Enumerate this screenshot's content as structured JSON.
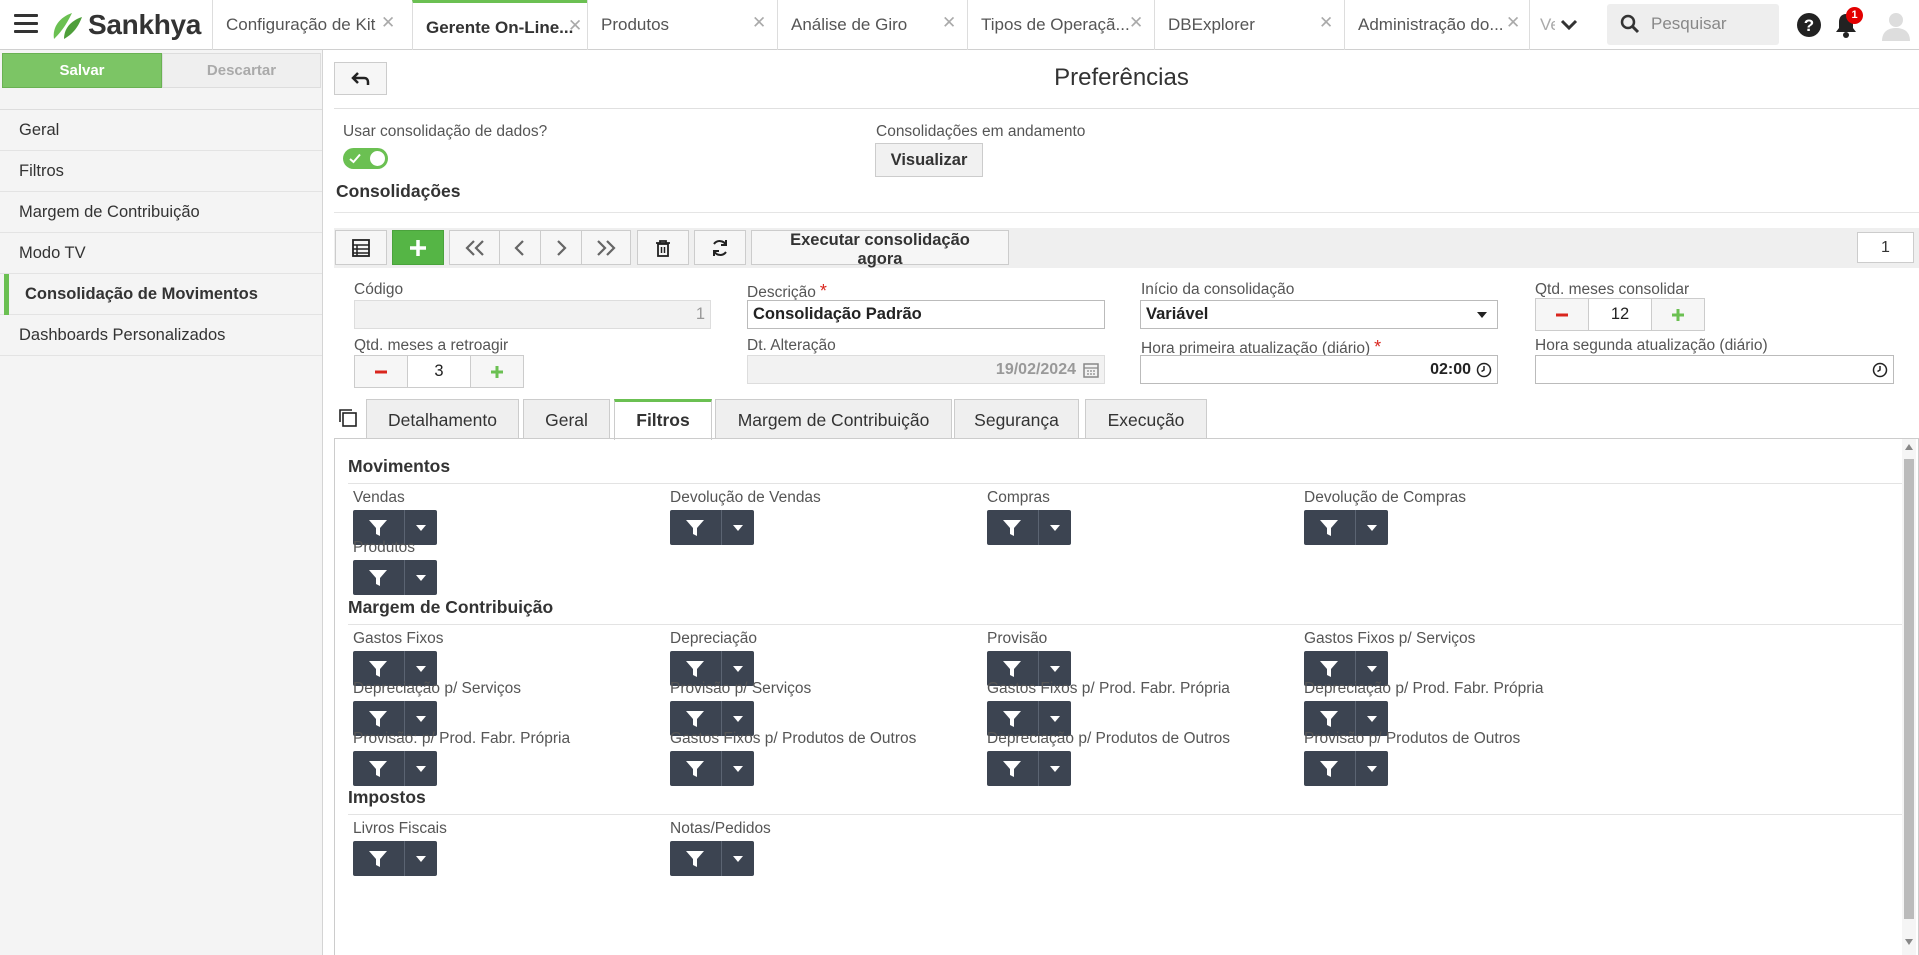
{
  "app": {
    "brand": "Sankhya",
    "accent_color": "#6bc052",
    "dark_button_color": "#3c4451"
  },
  "tabs": [
    {
      "label": "Configuração de Kit",
      "active": false
    },
    {
      "label": "Gerente On-Line...",
      "active": true
    },
    {
      "label": "Produtos",
      "active": false
    },
    {
      "label": "Análise de Giro",
      "active": false
    },
    {
      "label": "Tipos de Operaçã...",
      "active": false
    },
    {
      "label": "DBExplorer",
      "active": false
    },
    {
      "label": "Administração do...",
      "active": false
    },
    {
      "label": "Ve",
      "active": false
    }
  ],
  "search": {
    "placeholder": "Pesquisar"
  },
  "notifications": {
    "count": "1"
  },
  "icons": {
    "menu": "hamburger-icon",
    "help": "help-icon",
    "bell": "bell-icon",
    "user": "user-avatar-icon",
    "search": "search-icon"
  },
  "sidebar": {
    "save_label": "Salvar",
    "discard_label": "Descartar",
    "items": [
      {
        "label": "Geral",
        "active": false
      },
      {
        "label": "Filtros",
        "active": false
      },
      {
        "label": "Margem de Contribuição",
        "active": false
      },
      {
        "label": "Modo TV",
        "active": false
      },
      {
        "label": "Consolidação de Movimentos",
        "active": true
      },
      {
        "label": "Dashboards Personalizados",
        "active": false
      }
    ]
  },
  "page": {
    "title": "Preferências",
    "use_consolidation_label": "Usar consolidação de dados?",
    "use_consolidation_on": true,
    "ongoing_label": "Consolidações em andamento",
    "view_button": "Visualizar",
    "section_title": "Consolidações"
  },
  "toolbar": {
    "exec_label": "Executar consolidação agora",
    "page": "1"
  },
  "form": {
    "codigo_label": "Código",
    "codigo_value": "1",
    "descricao_label": "Descrição",
    "descricao_value": "Consolidação Padrão",
    "inicio_label": "Início da consolidação",
    "inicio_value": "Variável",
    "qtd_meses_label": "Qtd. meses consolidar",
    "qtd_meses_value": "12",
    "retroagir_label": "Qtd. meses a retroagir",
    "retroagir_value": "3",
    "dt_alt_label": "Dt. Alteração",
    "dt_alt_value": "19/02/2024",
    "hora1_label": "Hora primeira atualização (diário)",
    "hora1_value": "02:00",
    "hora2_label": "Hora segunda atualização (diário)",
    "hora2_value": "",
    "required_mark": "*"
  },
  "detail_tabs": [
    {
      "label": "Detalhamento",
      "active": false
    },
    {
      "label": "Geral",
      "active": false
    },
    {
      "label": "Filtros",
      "active": true
    },
    {
      "label": "Margem de Contribuição",
      "active": false
    },
    {
      "label": "Segurança",
      "active": false
    },
    {
      "label": "Execução",
      "active": false
    }
  ],
  "filters": {
    "groups": [
      {
        "title": "Movimentos",
        "items": [
          "Vendas",
          "Devolução de Vendas",
          "Compras",
          "Devolução de Compras",
          "Produtos"
        ]
      },
      {
        "title": "Margem de Contribuição",
        "items": [
          "Gastos Fixos",
          "Depreciação",
          "Provisão",
          "Gastos Fixos p/ Serviços",
          "Depreciação p/ Serviços",
          "Provisão p/ Serviços",
          "Gastos Fixos p/ Prod. Fabr. Própria",
          "Depreciação p/ Prod. Fabr. Própria",
          "Provisão: p/ Prod. Fabr. Própria",
          "Gastos Fixos p/ Produtos de Outros",
          "Depreciação p/ Produtos de Outros",
          "Provisão p/ Produtos de Outros"
        ]
      },
      {
        "title": "Impostos",
        "items": [
          "Livros Fiscais",
          "Notas/Pedidos"
        ]
      }
    ]
  }
}
